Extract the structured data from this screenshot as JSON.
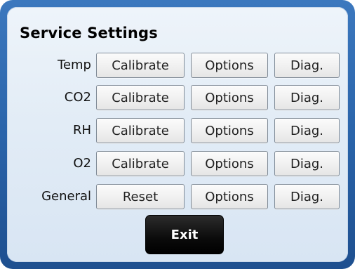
{
  "title": "Service Settings",
  "rows": [
    {
      "label": "Temp",
      "action": "Calibrate",
      "options": "Options",
      "diag": "Diag."
    },
    {
      "label": "CO2",
      "action": "Calibrate",
      "options": "Options",
      "diag": "Diag."
    },
    {
      "label": "RH",
      "action": "Calibrate",
      "options": "Options",
      "diag": "Diag."
    },
    {
      "label": "O2",
      "action": "Calibrate",
      "options": "Options",
      "diag": "Diag."
    },
    {
      "label": "General",
      "action": "Reset",
      "options": "Options",
      "diag": "Diag."
    }
  ],
  "exit_label": "Exit",
  "colors": {
    "frame": "#2a64aa",
    "panel": "#e2ecf6",
    "exit_button": "#000000"
  }
}
